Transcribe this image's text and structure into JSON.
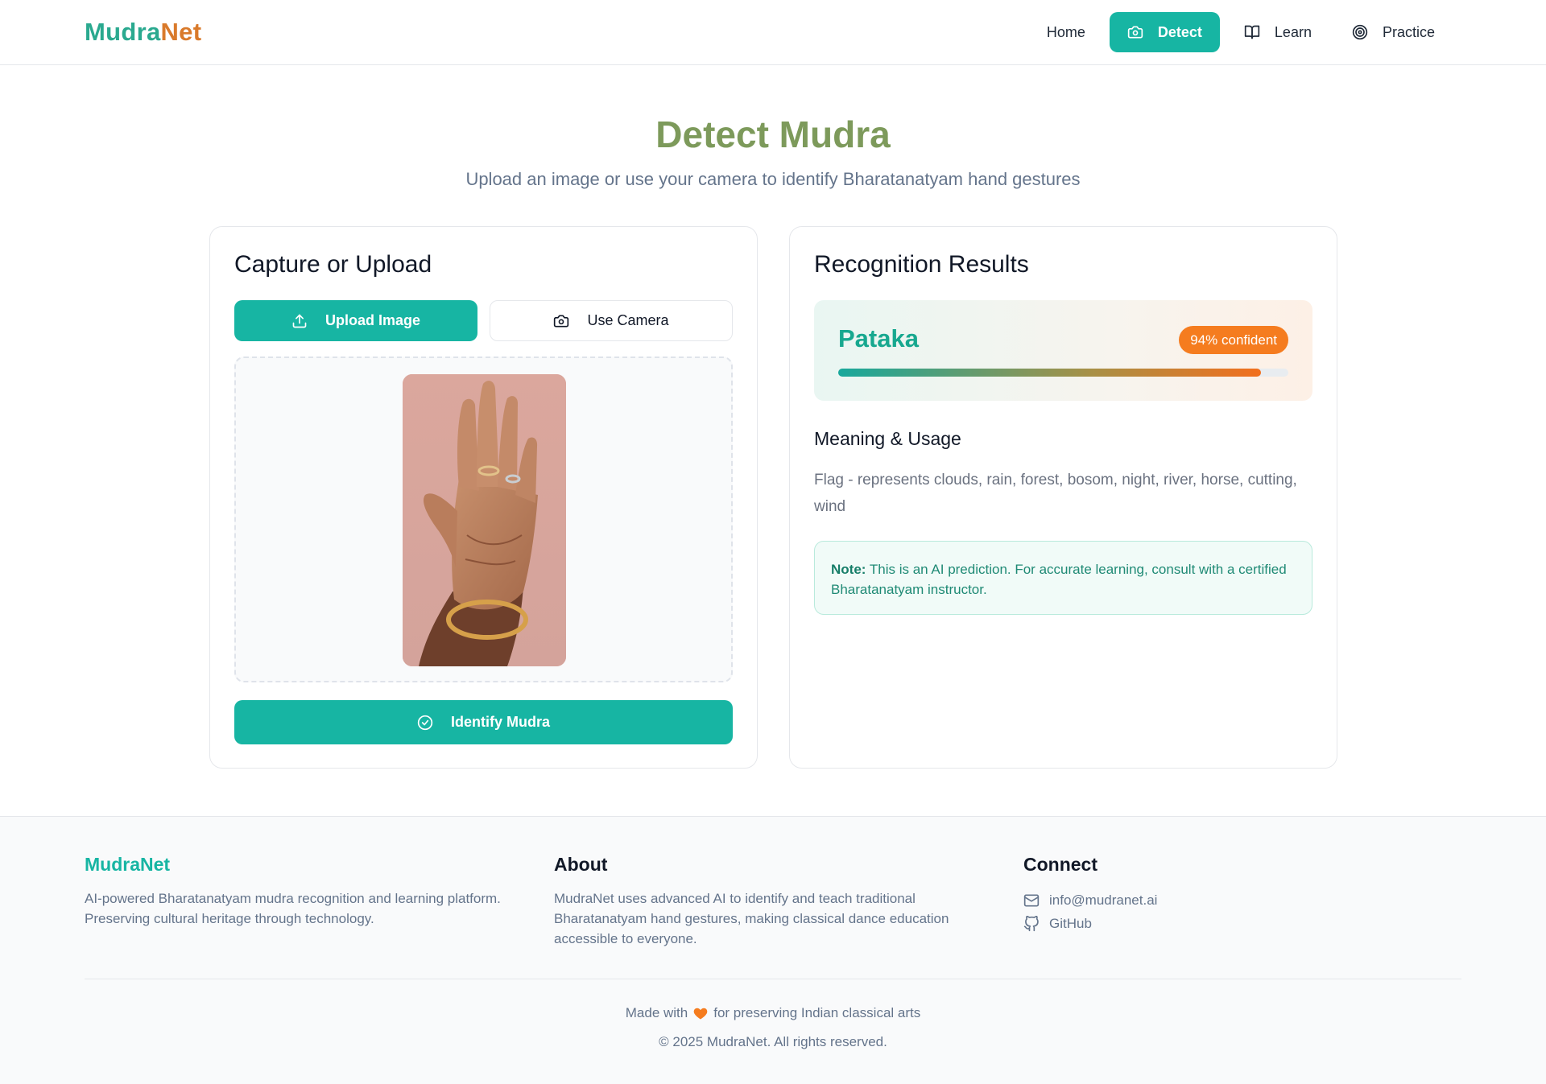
{
  "brand": {
    "part1": "Mudra",
    "part2": "Net"
  },
  "nav": {
    "home": "Home",
    "detect": "Detect",
    "learn": "Learn",
    "practice": "Practice"
  },
  "hero": {
    "title": "Detect Mudra",
    "subtitle": "Upload an image or use your camera to identify Bharatanatyam hand gestures"
  },
  "capture": {
    "heading": "Capture or Upload",
    "upload_label": "Upload Image",
    "camera_label": "Use Camera",
    "identify_label": "Identify Mudra"
  },
  "results": {
    "heading": "Recognition Results",
    "mudra_name": "Pataka",
    "confidence_label": "94% confident",
    "confidence": 0.94,
    "meaning_heading": "Meaning & Usage",
    "meaning_text": "Flag - represents clouds, rain, forest, bosom, night, river, horse, cutting, wind",
    "note_label": "Note:",
    "note_text": " This is an AI prediction. For accurate learning, consult with a certified Bharatanatyam instructor."
  },
  "footer": {
    "brand": "MudraNet",
    "brand_desc": "AI-powered Bharatanatyam mudra recognition and learning platform. Preserving cultural heritage through technology.",
    "about_heading": "About",
    "about_text": "MudraNet uses advanced AI to identify and teach traditional Bharatanatyam hand gestures, making classical dance education accessible to everyone.",
    "connect_heading": "Connect",
    "email": "info@mudranet.ai",
    "github": "GitHub",
    "made_with_prefix": "Made with",
    "made_with_suffix": "for preserving Indian classical arts",
    "copyright": "© 2025 MudraNet. All rights reserved."
  },
  "colors": {
    "accent": "#17b5a3",
    "orange": "#f57c1f",
    "title_green": "#7d9a5b"
  }
}
